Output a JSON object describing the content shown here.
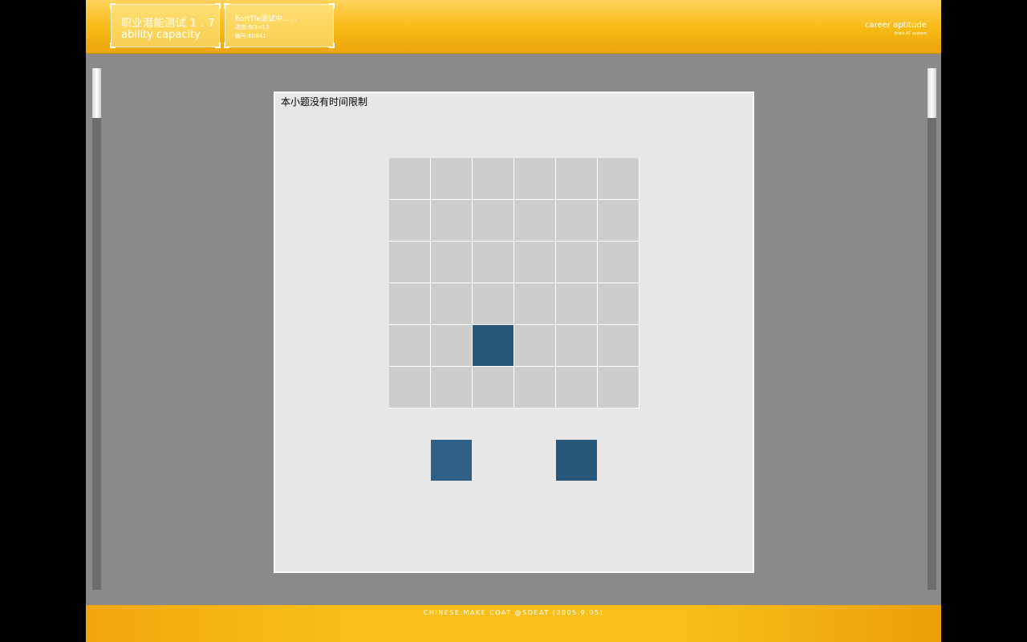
{
  "header": {
    "title_cn": "职业潜能测试 1 . 7",
    "title_en": "ability capacity",
    "status_line": "EortTle测试中……",
    "progress_line": "进度:6/3>13",
    "code_line": "编号:E0841",
    "brand_title": "career aptitude",
    "brand_sub": "Brain AT system"
  },
  "question": {
    "notice": "本小题没有时间限制",
    "grid": {
      "rows": 6,
      "cols": 6,
      "filled_cells": [
        [
          4,
          2
        ]
      ]
    },
    "options": [
      "option-a",
      "option-b"
    ]
  },
  "footer": {
    "credit": "CHINESE.MAKE   COAT   @SDEAT  (2005.9.05)"
  },
  "colors": {
    "header": "#f7b915",
    "panel": "#e7e7e7",
    "cell": "#cdcdcd",
    "filled": "#28577c",
    "background": "#8a8a8a"
  }
}
